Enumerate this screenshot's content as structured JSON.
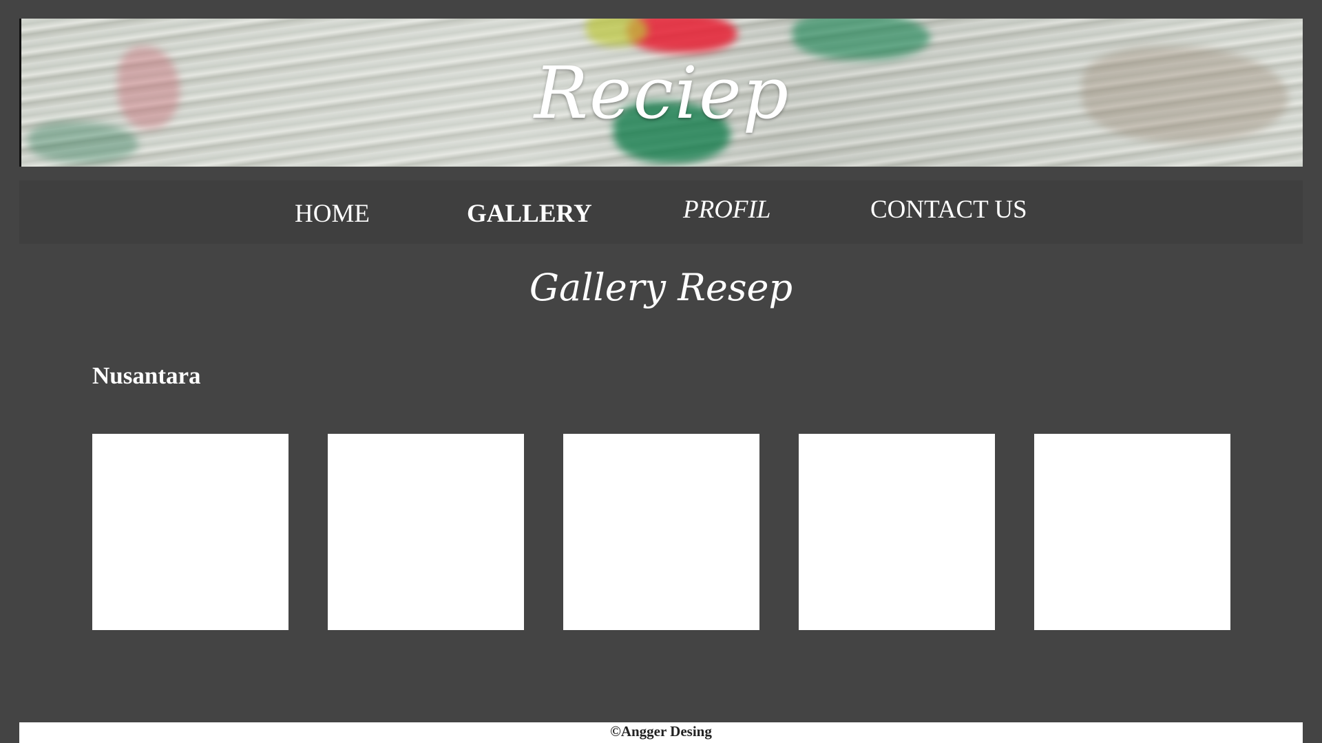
{
  "header": {
    "site_title": "Reciep"
  },
  "nav": {
    "items": [
      {
        "label": "HOME"
      },
      {
        "label": "GALLERY"
      },
      {
        "label": "PROFIL"
      },
      {
        "label": "CONTACT US"
      }
    ],
    "active": "GALLERY"
  },
  "main": {
    "page_title": "Gallery Resep",
    "section": {
      "title": "Nusantara",
      "tile_count": 5
    }
  },
  "footer": {
    "copyright": "©Angger Desing"
  },
  "colors": {
    "background": "#444444",
    "nav_background": "#3f3f3f",
    "text": "#ffffff",
    "tile": "#ffffff",
    "footer_background": "#ffffff",
    "footer_text": "#222222"
  }
}
